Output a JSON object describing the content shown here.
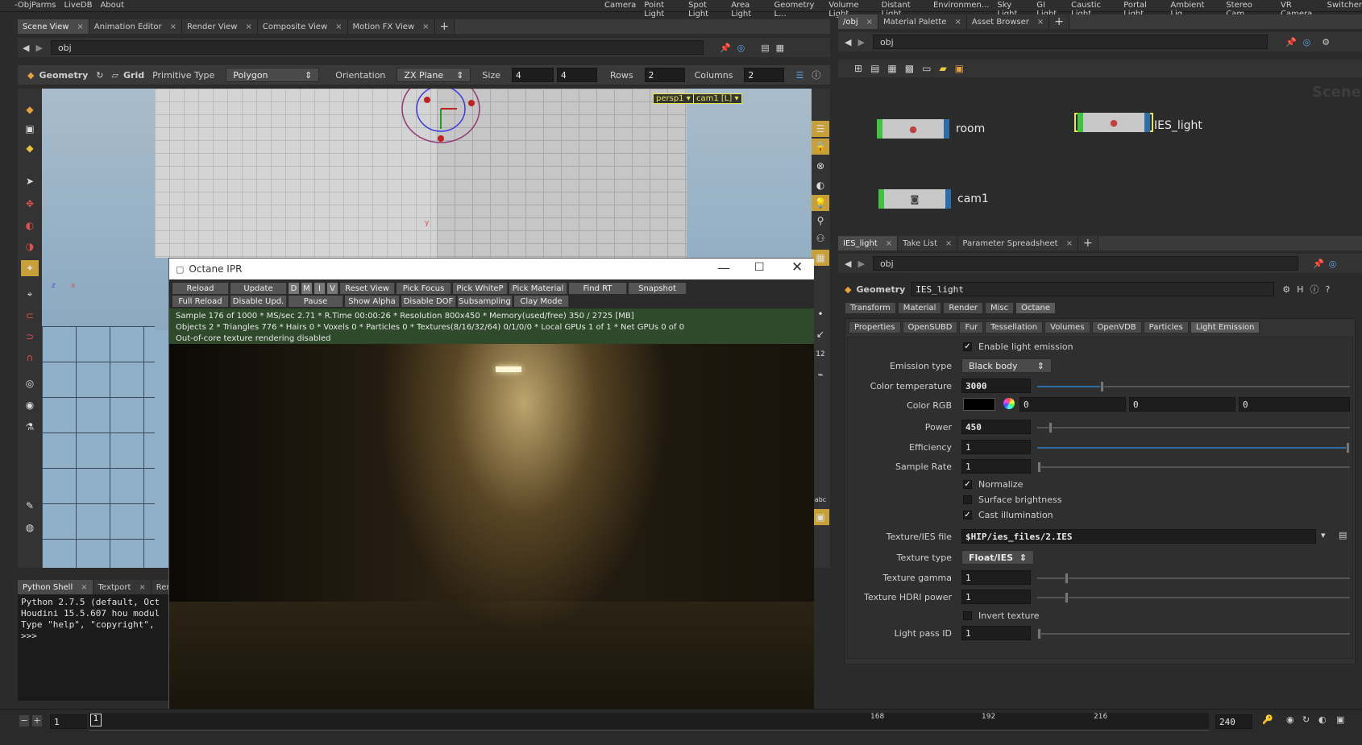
{
  "menubar": {
    "left_items": [
      "-ObjParms",
      "LiveDB",
      "About"
    ],
    "shelf_items": [
      "Camera",
      "Point Light",
      "Spot Light",
      "Area Light",
      "Geometry L...",
      "Volume Light",
      "Distant Light",
      "Environmen...",
      "Sky Light",
      "GI Light",
      "Caustic Light",
      "Portal Light",
      "Ambient Lig...",
      "Stereo Cam...",
      "VR Camera",
      "Switcher"
    ]
  },
  "left_tabs": [
    {
      "label": "Scene View"
    },
    {
      "label": "Animation Editor"
    },
    {
      "label": "Render View"
    },
    {
      "label": "Composite View"
    },
    {
      "label": "Motion FX View"
    }
  ],
  "left_path": "obj",
  "tool_options": {
    "context": "Geometry",
    "tool": "Grid",
    "primitive_type_label": "Primitive Type",
    "primitive_type_value": "Polygon",
    "orientation_label": "Orientation",
    "orientation_value": "ZX Plane",
    "size_label": "Size",
    "size_x": "4",
    "size_y": "4",
    "rows_label": "Rows",
    "rows_value": "2",
    "columns_label": "Columns",
    "columns_value": "2"
  },
  "viewport": {
    "persp_label": "persp1",
    "cam_label": "cam1 [L]",
    "axis_y": "y",
    "axis_z": "z",
    "axis_x": "x"
  },
  "ipr": {
    "title": "Octane IPR",
    "row1": [
      "Reload",
      "Update",
      "D",
      "M",
      "I",
      "V",
      "Reset View",
      "Pick Focus",
      "Pick WhiteP",
      "Pick Material",
      "Find RT",
      "Snapshot"
    ],
    "row2": [
      "Full Reload",
      "Disable Upd.",
      "Pause",
      "Show Alpha",
      "Disable DOF",
      "Subsampling",
      "Clay Mode"
    ],
    "status1": "Sample 176 of 1000 * MS/sec 2.71 * R.Time 00:00:26 * Resolution 800x450 * Memory(used/free) 350 / 2725 [MB]",
    "status2": "Objects 2 * Triangles 776 * Hairs 0 * Voxels 0 * Particles 0 * Textures(8/16/32/64) 0/1/0/0 * Local GPUs 1 of 1 * Net GPUs 0 of 0",
    "status3": "Out-of-core texture rendering disabled"
  },
  "shell": {
    "tabs": [
      "Python Shell",
      "Textport",
      "Rend"
    ],
    "lines": [
      "Python 2.7.5 (default, Oct",
      "Houdini 15.5.607 hou modul",
      "Type \"help\", \"copyright\",",
      ">>>"
    ]
  },
  "timeline": {
    "start": "1",
    "current": "1",
    "ticks": [
      "168",
      "192",
      "216"
    ],
    "end": "240"
  },
  "network": {
    "tabs": [
      "/obj",
      "Material Palette",
      "Asset Browser"
    ],
    "path": "obj",
    "watermark": "Scene",
    "nodes": [
      "room",
      "IES_light",
      "cam1"
    ]
  },
  "params": {
    "tabs": [
      "IES_light",
      "Take List",
      "Parameter Spreadsheet"
    ],
    "path": "obj",
    "type": "Geometry",
    "name": "IES_light",
    "main_tabs": [
      "Transform",
      "Material",
      "Render",
      "Misc",
      "Octane"
    ],
    "sub_tabs": [
      "Properties",
      "OpenSUBD",
      "Fur",
      "Tessellation",
      "Volumes",
      "OpenVDB",
      "Particles",
      "Light Emission"
    ],
    "enable_light_emission": "Enable light emission",
    "emission_type_label": "Emission type",
    "emission_type_value": "Black body",
    "color_temperature_label": "Color temperature",
    "color_temperature_value": "3000",
    "color_rgb_label": "Color RGB",
    "color_rgb_values": [
      "0",
      "0",
      "0"
    ],
    "power_label": "Power",
    "power_value": "450",
    "efficiency_label": "Efficiency",
    "efficiency_value": "1",
    "sample_rate_label": "Sample Rate",
    "sample_rate_value": "1",
    "normalize": "Normalize",
    "surface_brightness": "Surface brightness",
    "cast_illumination": "Cast illumination",
    "texture_file_label": "Texture/IES file",
    "texture_file_value": "$HIP/ies_files/2.IES",
    "texture_type_label": "Texture type",
    "texture_type_value": "Float/IES",
    "texture_gamma_label": "Texture gamma",
    "texture_gamma_value": "1",
    "texture_hdri_label": "Texture HDRI power",
    "texture_hdri_value": "1",
    "invert_texture": "Invert texture",
    "light_pass_label": "Light pass ID",
    "light_pass_value": "1"
  },
  "colors": {
    "accent_blue": "#2e6ea8",
    "node_green": "#3ec43e",
    "node_selected": "#e8e84a",
    "ipr_status_bg": "#2f4a2b",
    "viewport_label": "#e8e84a"
  }
}
